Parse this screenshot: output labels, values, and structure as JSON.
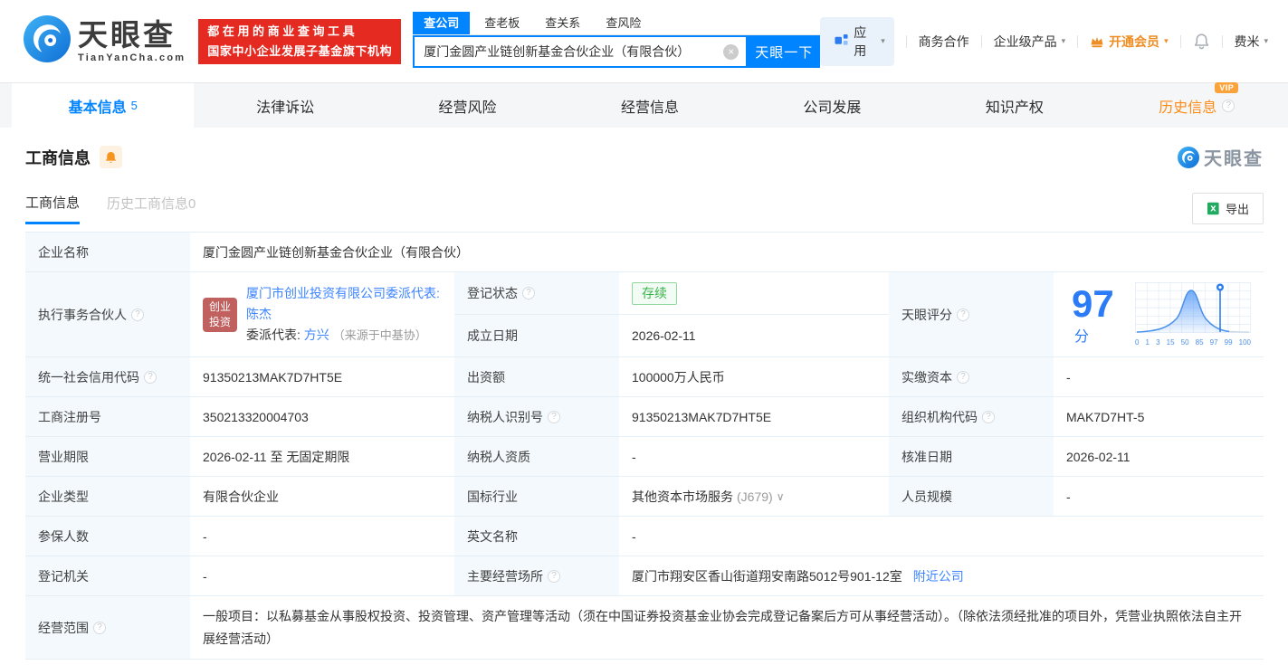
{
  "brand": {
    "name": "天眼查",
    "domain": "TianYanCha.com"
  },
  "banner": {
    "line1": "都在用的商业查询工具",
    "line2": "国家中小企业发展子基金旗下机构"
  },
  "search": {
    "tabs": [
      {
        "label": "查公司",
        "active": true
      },
      {
        "label": "查老板",
        "active": false
      },
      {
        "label": "查关系",
        "active": false
      },
      {
        "label": "查风险",
        "active": false
      }
    ],
    "value": "厦门金圆产业链创新基金合伙企业（有限合伙）",
    "button": "天眼一下"
  },
  "top_nav": {
    "apps": "应用",
    "cooperation": "商务合作",
    "enterprise": "企业级产品",
    "vip": "开通会员",
    "user": "费米"
  },
  "main_tabs": [
    {
      "label": "基本信息",
      "count": "5",
      "active": true
    },
    {
      "label": "法律诉讼"
    },
    {
      "label": "经营风险"
    },
    {
      "label": "经营信息"
    },
    {
      "label": "公司发展"
    },
    {
      "label": "知识产权"
    },
    {
      "label": "历史信息",
      "vip": "VIP"
    }
  ],
  "section": {
    "title": "工商信息"
  },
  "watermark": {
    "name": "天眼查"
  },
  "sub_tabs": [
    {
      "label": "工商信息",
      "active": true
    },
    {
      "label": "历史工商信息0",
      "active": false
    }
  ],
  "export_button": "导出",
  "score": {
    "label": "天眼评分",
    "value": "97",
    "unit": "分",
    "chart": {
      "type": "area",
      "x_labels": [
        "0",
        "1",
        "3",
        "15",
        "50",
        "85",
        "97",
        "99",
        "100"
      ],
      "marker_at": "97"
    }
  },
  "fields": {
    "company_name": {
      "label": "企业名称",
      "value": "厦门金圆产业链创新基金合伙企业（有限合伙）"
    },
    "executive_partner": {
      "label": "执行事务合伙人",
      "badge_line1": "创业",
      "badge_line2": "投资",
      "link_company": "厦门市创业投资有限公司委派代表: ",
      "link_person1": "陈杰",
      "rep_label": "委派代表: ",
      "link_person2": "方兴",
      "rep_source": "（来源于中基协）"
    },
    "reg_status": {
      "label": "登记状态",
      "value": "存续"
    },
    "establish_date": {
      "label": "成立日期",
      "value": "2026-02-11"
    },
    "credit_code": {
      "label": "统一社会信用代码",
      "value": "91350213MAK7D7HT5E"
    },
    "capital": {
      "label": "出资额",
      "value": "100000万人民币"
    },
    "paid_capital": {
      "label": "实缴资本",
      "value": "-"
    },
    "reg_number": {
      "label": "工商注册号",
      "value": "350213320004703"
    },
    "taxpayer_id": {
      "label": "纳税人识别号",
      "value": "91350213MAK7D7HT5E"
    },
    "org_code": {
      "label": "组织机构代码",
      "value": "MAK7D7HT-5"
    },
    "business_term": {
      "label": "营业期限",
      "value": "2026-02-11 至 无固定期限"
    },
    "taxpayer_quality": {
      "label": "纳税人资质",
      "value": "-"
    },
    "approval_date": {
      "label": "核准日期",
      "value": "2026-02-11"
    },
    "company_type": {
      "label": "企业类型",
      "value": "有限合伙企业"
    },
    "industry": {
      "label": "国标行业",
      "value": "其他资本市场服务",
      "code": "(J679)"
    },
    "staff_size": {
      "label": "人员规模",
      "value": "-"
    },
    "insured_count": {
      "label": "参保人数",
      "value": "-"
    },
    "english_name": {
      "label": "英文名称",
      "value": "-"
    },
    "reg_authority": {
      "label": "登记机关",
      "value": "-"
    },
    "business_location": {
      "label": "主要经营场所",
      "value": "厦门市翔安区香山街道翔安南路5012号901-12室",
      "link": "附近公司"
    },
    "business_scope": {
      "label": "经营范围",
      "value": "一般项目：以私募基金从事股权投资、投资管理、资产管理等活动（须在中国证券投资基金业协会完成登记备案后方可从事经营活动）。（除依法须经批准的项目外，凭营业执照依法自主开展经营活动）"
    }
  },
  "ui": {
    "help_glyph": "?",
    "caret": "▾",
    "clear_glyph": "×",
    "industry_caret": "∨"
  },
  "colors": {
    "accent_blue": "#0084ff",
    "link_blue": "#3d84ff",
    "vip_orange": "#ff8b17",
    "banner_red": "#e42a21",
    "status_green": "#39b54a",
    "badge_rose": "#c0605f",
    "label_cell_bg": "#f3f9fd",
    "table_border": "#e5eff7"
  }
}
